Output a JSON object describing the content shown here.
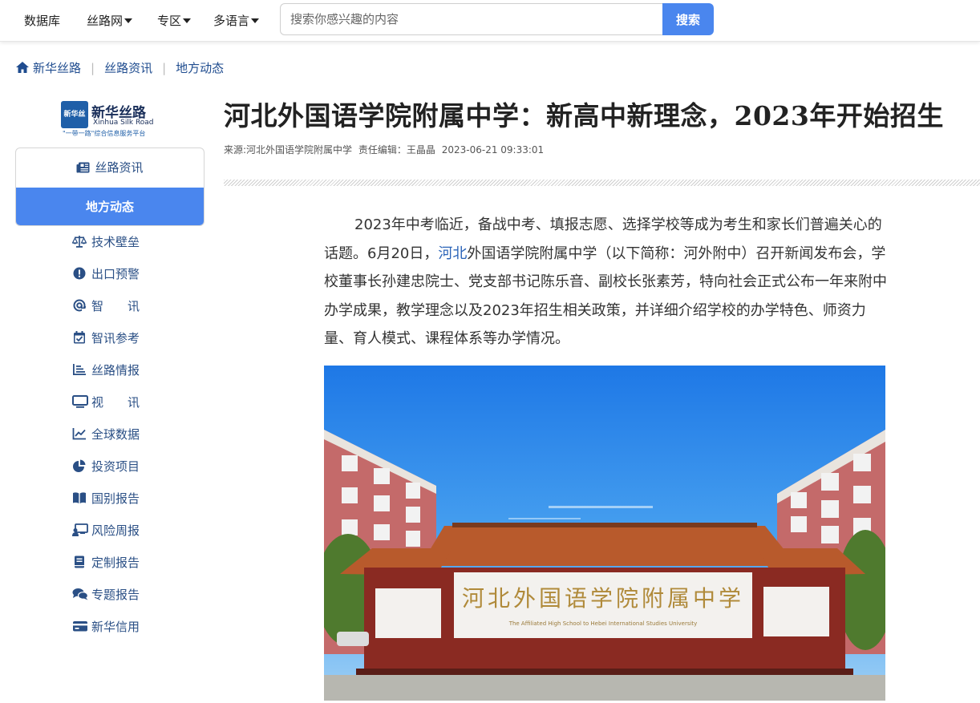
{
  "topnav": {
    "items": [
      {
        "label": "数据库",
        "dropdown": false
      },
      {
        "label": "丝路网",
        "dropdown": true
      },
      {
        "label": "专区",
        "dropdown": true
      },
      {
        "label": "多语言",
        "dropdown": true
      }
    ],
    "search_placeholder": "搜索你感兴趣的内容",
    "search_button": "搜索"
  },
  "breadcrumb": {
    "home": "新华丝路",
    "level2": "丝路资讯",
    "level3": "地方动态"
  },
  "logo": {
    "mark": "新华丝路",
    "cn": "新华丝路",
    "en": "Xinhua Silk Road",
    "sub": "\"一带一路\"综合信息服务平台"
  },
  "sidebar": {
    "card": {
      "item1": "丝路资讯",
      "active": "地方动态"
    },
    "items": [
      {
        "label": "技术壁垒",
        "icon": "scale-icon"
      },
      {
        "label": "出口预警",
        "icon": "alert-icon"
      },
      {
        "label": "智　　讯",
        "icon": "at-icon"
      },
      {
        "label": "智讯参考",
        "icon": "calendar-check-icon"
      },
      {
        "label": "丝路情报",
        "icon": "list-chart-icon"
      },
      {
        "label": "视　　讯",
        "icon": "monitor-icon"
      },
      {
        "label": "全球数据",
        "icon": "line-chart-icon"
      },
      {
        "label": "投资项目",
        "icon": "pie-chart-icon"
      },
      {
        "label": "国别报告",
        "icon": "book-icon"
      },
      {
        "label": "风险周报",
        "icon": "presenter-icon"
      },
      {
        "label": "定制报告",
        "icon": "document-icon"
      },
      {
        "label": "专题报告",
        "icon": "comments-icon"
      },
      {
        "label": "新华信用",
        "icon": "credit-card-icon"
      }
    ]
  },
  "article": {
    "title": "河北外国语学院附属中学：新高中新理念，2023年开始招生",
    "source": "来源:河北外国语学院附属中学",
    "editor": "责任编辑：王晶晶",
    "datetime": "2023-06-21 09:33:01",
    "para_before_link": "2023年中考临近，备战中考、填报志愿、选择学校等成为考生和家长们普遍关心的话题。6月20日，",
    "para_link": "河北",
    "para_after_link": "外国语学院附属中学（以下简称：河外附中）召开新闻发布会，学校董事长孙建忠院士、党支部书记陈乐音、副校长张素芳，特向社会正式公布一年来附中办学成果，教学理念以及2023年招生相关政策，并详细介绍学校的办学特色、师资力量、育人模式、课程体系等办学情况。",
    "photo_sign_cn": "河北外国语学院附属中学",
    "photo_sign_en": "The Affiliated High School to Hebei International Studies University"
  },
  "colors": {
    "accent": "#4a86ee",
    "link": "#2a63b8",
    "nav_text": "#2a4f85"
  }
}
